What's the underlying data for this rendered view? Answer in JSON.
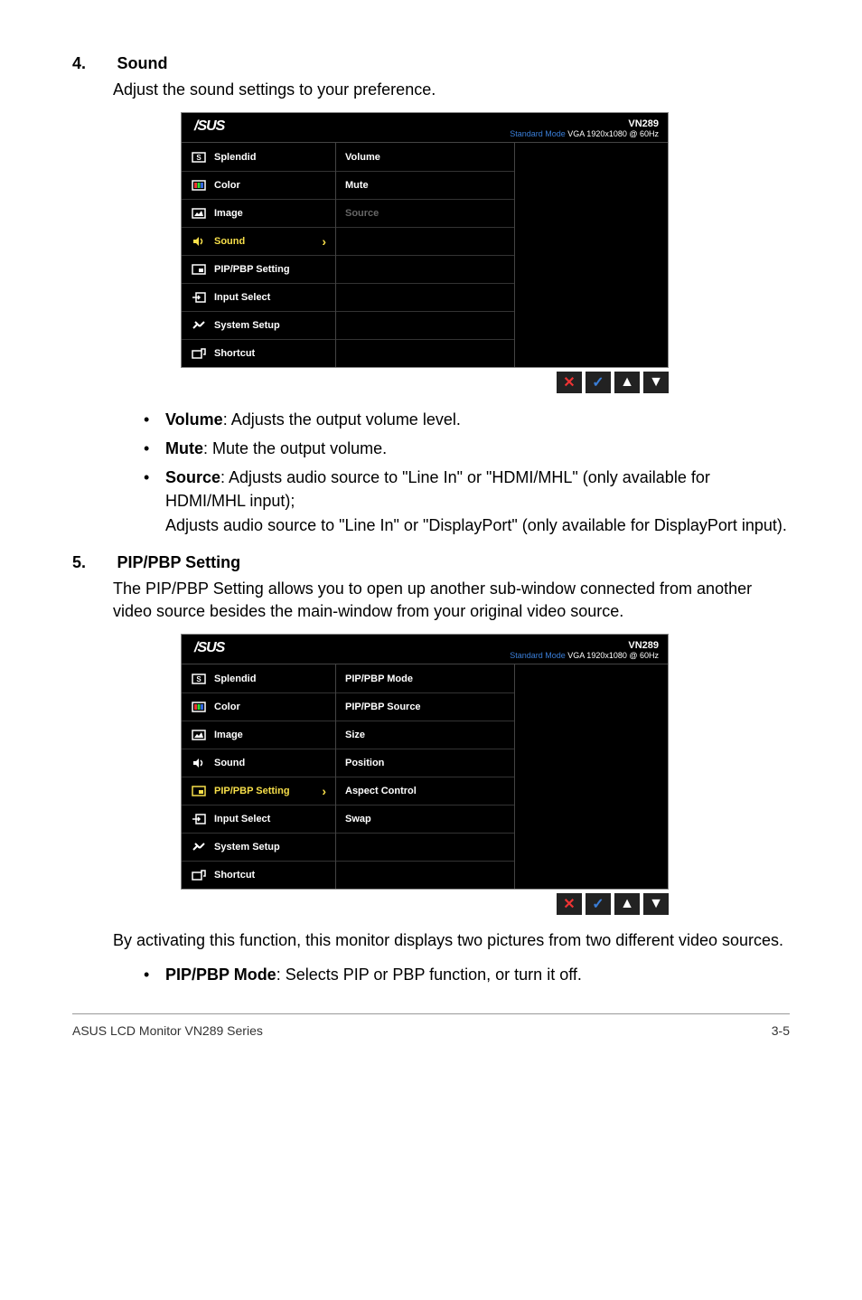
{
  "sections": {
    "sound": {
      "num": "4.",
      "title": "Sound",
      "desc": "Adjust the sound settings to your preference."
    },
    "pip": {
      "num": "5.",
      "title": "PIP/PBP Setting",
      "desc": "The PIP/PBP Setting allows you to open up another sub-window connected from another video source besides the main-window from your original video source.",
      "post": "By activating this function, this monitor displays two pictures from two different video sources."
    }
  },
  "osd_common": {
    "logo": "/SUS",
    "model": "VN289",
    "mode_prefix": "Standard Mode",
    "mode_suffix": "VGA 1920x1080 @ 60Hz"
  },
  "osd_sound_col1": [
    {
      "icon": "splendid",
      "label": "Splendid"
    },
    {
      "icon": "color",
      "label": "Color"
    },
    {
      "icon": "image",
      "label": "Image"
    },
    {
      "icon": "sound",
      "label": "Sound",
      "active": true
    },
    {
      "icon": "pip",
      "label": "PIP/PBP Setting"
    },
    {
      "icon": "input",
      "label": "Input Select"
    },
    {
      "icon": "setup",
      "label": "System Setup"
    },
    {
      "icon": "shortcut",
      "label": "Shortcut"
    }
  ],
  "osd_sound_col2": [
    {
      "label": "Volume"
    },
    {
      "label": "Mute"
    },
    {
      "label": "Source",
      "disabled": true
    },
    {
      "label": ""
    },
    {
      "label": ""
    },
    {
      "label": ""
    },
    {
      "label": ""
    },
    {
      "label": ""
    }
  ],
  "osd_pip_col1": [
    {
      "icon": "splendid",
      "label": "Splendid"
    },
    {
      "icon": "color",
      "label": "Color"
    },
    {
      "icon": "image",
      "label": "Image"
    },
    {
      "icon": "sound",
      "label": "Sound"
    },
    {
      "icon": "pip",
      "label": "PIP/PBP Setting",
      "active": true
    },
    {
      "icon": "input",
      "label": "Input Select"
    },
    {
      "icon": "setup",
      "label": "System Setup"
    },
    {
      "icon": "shortcut",
      "label": "Shortcut"
    }
  ],
  "osd_pip_col2": [
    {
      "label": "PIP/PBP Mode"
    },
    {
      "label": "PIP/PBP Source"
    },
    {
      "label": "Size"
    },
    {
      "label": "Position"
    },
    {
      "label": "Aspect Control"
    },
    {
      "label": "Swap"
    },
    {
      "label": ""
    },
    {
      "label": ""
    }
  ],
  "bullets_sound": {
    "volume_label": "Volume",
    "volume_text": ": Adjusts the output volume level.",
    "mute_label": "Mute",
    "mute_text": ": Mute the output volume.",
    "source_label": "Source",
    "source_text1": ": Adjusts audio source to \"Line In\" or \"HDMI/MHL\"  (only available for HDMI/MHL input);",
    "source_text2": "Adjusts audio source to \"Line In\" or \"DisplayPort\" (only available for DisplayPort input)."
  },
  "bullets_pip": {
    "mode_label": "PIP/PBP Mode",
    "mode_text": ": Selects PIP or PBP function, or turn it off."
  },
  "footer": {
    "left": "ASUS LCD Monitor VN289 Series",
    "right": "3-5"
  },
  "nav": {
    "close": "✕",
    "check": "✓",
    "up": "▲",
    "down": "▼"
  }
}
